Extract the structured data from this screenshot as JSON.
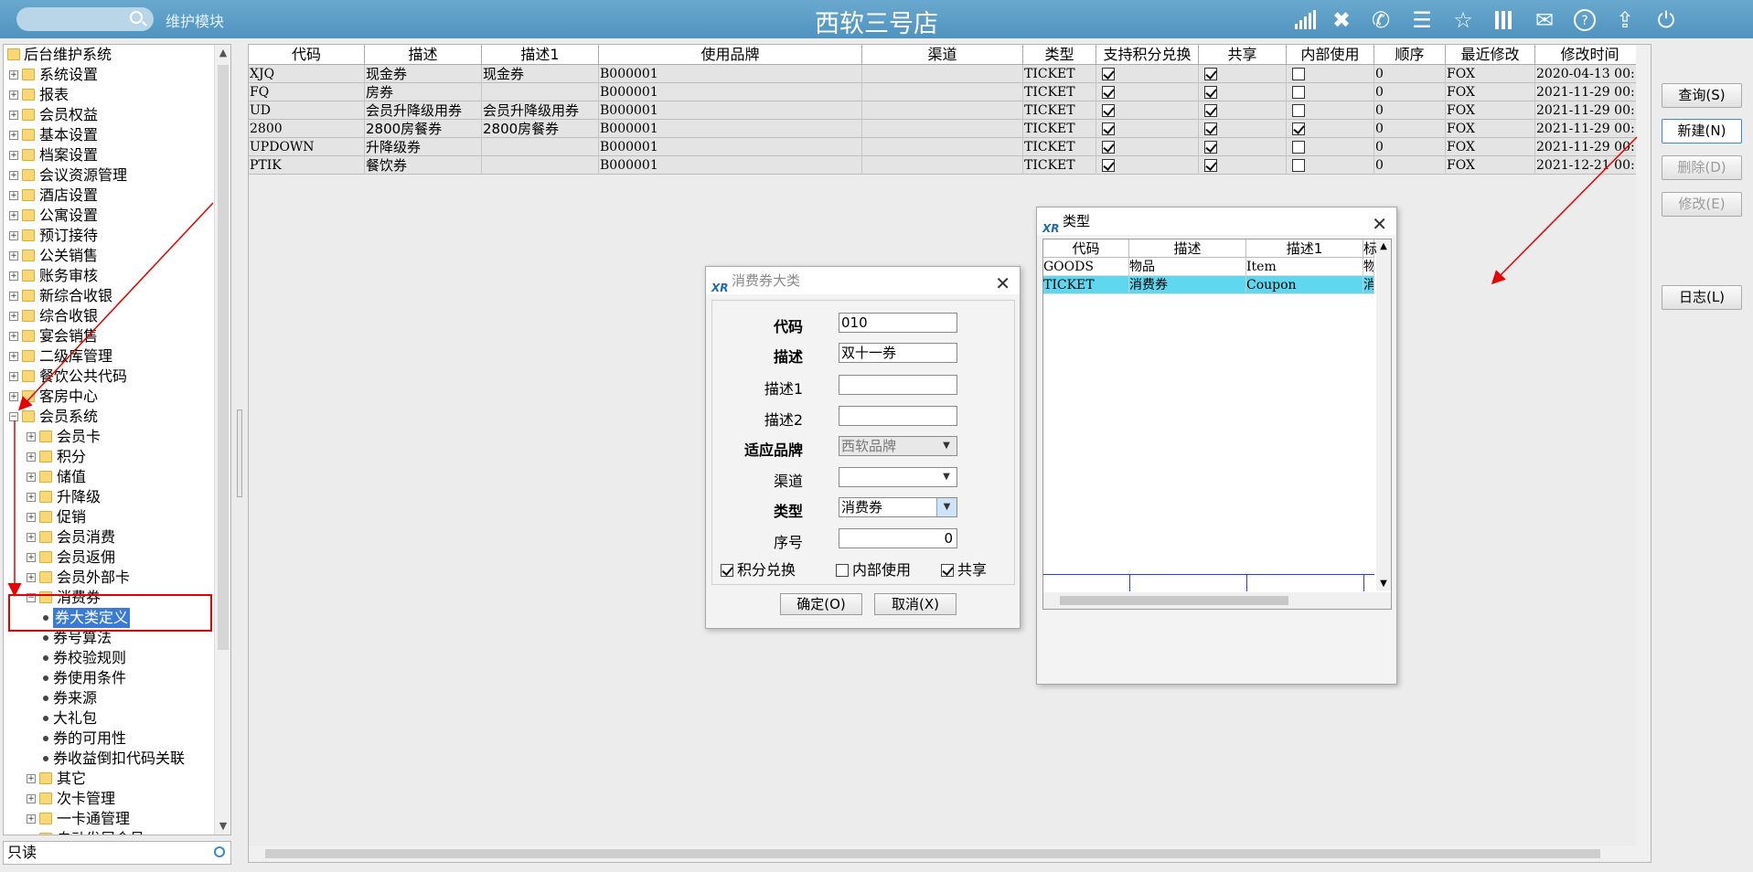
{
  "topbar": {
    "module_label": "维护模块",
    "store_title": "西软三号店",
    "icons": [
      "signal-icon",
      "tools-icon",
      "phone-icon",
      "menu-icon",
      "star-icon",
      "columns-icon",
      "mail-icon",
      "help-icon",
      "exit-icon",
      "power-icon"
    ]
  },
  "tree": {
    "root": "后台维护系统",
    "top_items": [
      "系统设置",
      "报表",
      "会员权益",
      "基本设置",
      "档案设置",
      "会议资源管理",
      "酒店设置",
      "公寓设置",
      "预订接待",
      "公关销售",
      "账务审核",
      "新综合收银",
      "综合收银",
      "宴会销售",
      "二级库管理",
      "餐饮公共代码",
      "客房中心",
      "会员系统"
    ],
    "member_children": [
      "会员卡",
      "积分",
      "储值",
      "升降级",
      "促销",
      "会员消费",
      "会员返佣",
      "会员外部卡",
      "消费券"
    ],
    "coupon_children": [
      "券大类定义",
      "券号算法",
      "券校验规则",
      "券使用条件",
      "券来源",
      "大礼包",
      "券的可用性",
      "券收益倒扣代码关联"
    ],
    "after_items": [
      "其它",
      "次卡管理",
      "一卡通管理",
      "自动发展会员"
    ],
    "selected": "券大类定义"
  },
  "readonly_field": "只读",
  "grid": {
    "headers": [
      "代码",
      "描述",
      "描述1",
      "使用品牌",
      "渠道",
      "类型",
      "支持积分兑换",
      "共享",
      "内部使用",
      "顺序",
      "最近修改",
      "修改时间"
    ],
    "rows": [
      {
        "code": "XJQ",
        "desc": "现金券",
        "desc1": "现金券",
        "brand": "B000001",
        "channel": "",
        "type": "TICKET",
        "points": true,
        "share": true,
        "internal": false,
        "order": "0",
        "modifier": "FOX",
        "time": "2020-04-13 00:"
      },
      {
        "code": "FQ",
        "desc": "房券",
        "desc1": "",
        "brand": "B000001",
        "channel": "",
        "type": "TICKET",
        "points": true,
        "share": true,
        "internal": false,
        "order": "0",
        "modifier": "FOX",
        "time": "2021-11-29 00:"
      },
      {
        "code": "UD",
        "desc": "会员升降级用券",
        "desc1": "会员升降级用券",
        "brand": "B000001",
        "channel": "",
        "type": "TICKET",
        "points": true,
        "share": true,
        "internal": false,
        "order": "0",
        "modifier": "FOX",
        "time": "2021-11-29 00:"
      },
      {
        "code": "2800",
        "desc": "2800房餐券",
        "desc1": "2800房餐券",
        "brand": "B000001",
        "channel": "",
        "type": "TICKET",
        "points": true,
        "share": true,
        "internal": true,
        "order": "0",
        "modifier": "FOX",
        "time": "2021-11-29 00:"
      },
      {
        "code": "UPDOWN",
        "desc": "升降级券",
        "desc1": "",
        "brand": "B000001",
        "channel": "",
        "type": "TICKET",
        "points": true,
        "share": true,
        "internal": false,
        "order": "0",
        "modifier": "FOX",
        "time": "2021-11-29 00:"
      },
      {
        "code": "PTIK",
        "desc": "餐饮券",
        "desc1": "",
        "brand": "B000001",
        "channel": "",
        "type": "TICKET",
        "points": true,
        "share": true,
        "internal": false,
        "order": "0",
        "modifier": "FOX",
        "time": "2021-12-21 00:"
      }
    ]
  },
  "side_buttons": {
    "query": "查询(S)",
    "new": "新建(N)",
    "delete": "删除(D)",
    "modify": "修改(E)",
    "log": "日志(L)"
  },
  "coupon_dialog": {
    "title": "消费券大类",
    "labels": {
      "code": "代码",
      "desc": "描述",
      "desc1": "描述1",
      "desc2": "描述2",
      "brand": "适应品牌",
      "channel": "渠道",
      "type": "类型",
      "order": "序号"
    },
    "values": {
      "code": "010",
      "desc": "双十一券",
      "desc1": "",
      "desc2": "",
      "brand": "西软品牌",
      "channel": "",
      "type": "消费券",
      "order": "0"
    },
    "checkboxes": {
      "points_label": "积分兑换",
      "points": true,
      "internal_label": "内部使用",
      "internal": false,
      "share_label": "共享",
      "share": true
    },
    "ok": "确定(O)",
    "cancel": "取消(X)"
  },
  "type_dialog": {
    "title": "类型",
    "headers": [
      "代码",
      "描述",
      "描述1",
      "标"
    ],
    "rows": [
      {
        "code": "GOODS",
        "desc": "物品",
        "desc1": "Item",
        "extra": "物"
      },
      {
        "code": "TICKET",
        "desc": "消费券",
        "desc1": "Coupon",
        "extra": "消",
        "selected": true
      }
    ]
  },
  "colors": {
    "topbar": "#5a9dc6",
    "annotation": "#e60000",
    "selection": "#3a7bd5",
    "type_selected": "#5fd7ef"
  }
}
